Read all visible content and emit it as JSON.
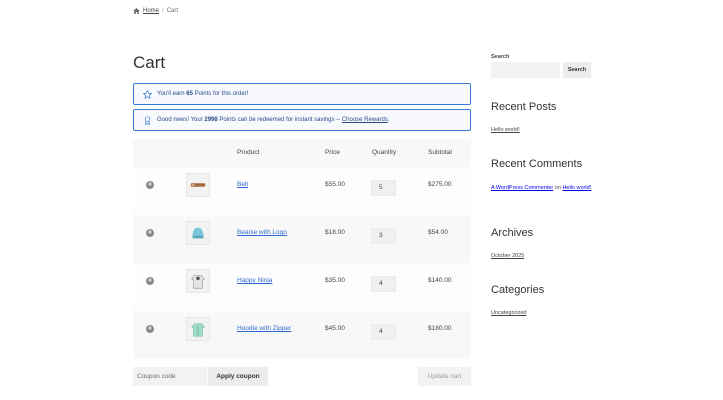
{
  "breadcrumb": {
    "home": "Home",
    "separator": "/",
    "current": "Cart",
    "icon": "home-icon"
  },
  "page_title": "Cart",
  "notices": [
    {
      "icon": "star-icon",
      "prefix": "You'll earn ",
      "bold": "65",
      "suffix": " Points for this order!"
    },
    {
      "icon": "award-icon",
      "prefix": "Good news! Your ",
      "bold": "2998",
      "suffix": " Points can be redeemed for instant savings -- ",
      "link": "Choose Rewards",
      "tail": "."
    }
  ],
  "table": {
    "headers": {
      "product": "Product",
      "price": "Price",
      "quantity": "Quantity",
      "subtotal": "Subtotal"
    },
    "rows": [
      {
        "name": "Belt",
        "price": "$55.00",
        "qty": "5",
        "subtotal": "$275.00",
        "thumb": "belt-icon"
      },
      {
        "name": "Beanie with Logo",
        "price": "$18.00",
        "qty": "3",
        "subtotal": "$54.00",
        "thumb": "beanie-icon"
      },
      {
        "name": "Happy Ninja",
        "price": "$35.00",
        "qty": "4",
        "subtotal": "$140.00",
        "thumb": "hoodie-icon"
      },
      {
        "name": "Hoodie with Zipper",
        "price": "$45.00",
        "qty": "4",
        "subtotal": "$180.00",
        "thumb": "zip-hoodie-icon"
      }
    ],
    "remove_glyph": "×"
  },
  "actions": {
    "coupon_placeholder": "Coupon code",
    "apply_label": "Apply coupon",
    "update_label": "Update cart"
  },
  "sidebar": {
    "search_label": "Search",
    "search_button": "Search",
    "recent_posts_title": "Recent Posts",
    "recent_post": "Hello world!",
    "recent_comments_title": "Recent Comments",
    "comment_author": "A WordPress Commenter",
    "comment_on": " on ",
    "comment_post": "Hello world!",
    "archives_title": "Archives",
    "archive_item": "October 2025",
    "categories_title": "Categories",
    "category_item": "Uncategorized"
  },
  "colors": {
    "accent": "#2f6cd6",
    "notice_border": "#3a7bd5"
  }
}
